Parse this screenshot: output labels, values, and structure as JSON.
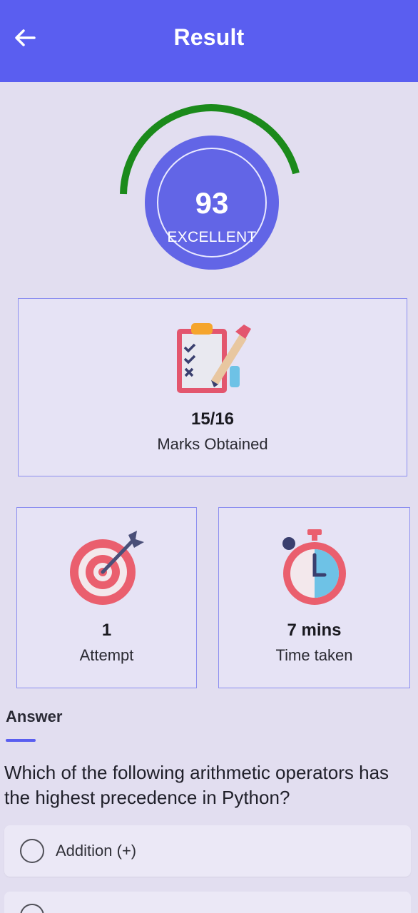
{
  "appbar": {
    "title": "Result",
    "back_icon": "arrow-left-icon",
    "color": "#5a5ef0"
  },
  "score": {
    "value": "93",
    "grade": "EXCELLENT",
    "gauge_level_percent": 93,
    "gauge_color": "#1b8a1b",
    "circle_color": "#6265e6"
  },
  "marks": {
    "icon": "clipboard-checklist-icon",
    "value": "15/16",
    "label": "Marks Obtained"
  },
  "attempt": {
    "icon": "target-icon",
    "value": "1",
    "label": "Attempt"
  },
  "time": {
    "icon": "stopwatch-icon",
    "value": "7 mins",
    "label": "Time taken"
  },
  "answer_section": {
    "title": "Answer",
    "question": "Which of the following arithmetic operators has the highest precedence in Python?",
    "options": [
      {
        "label": "Addition (+)",
        "selected": false
      }
    ]
  }
}
